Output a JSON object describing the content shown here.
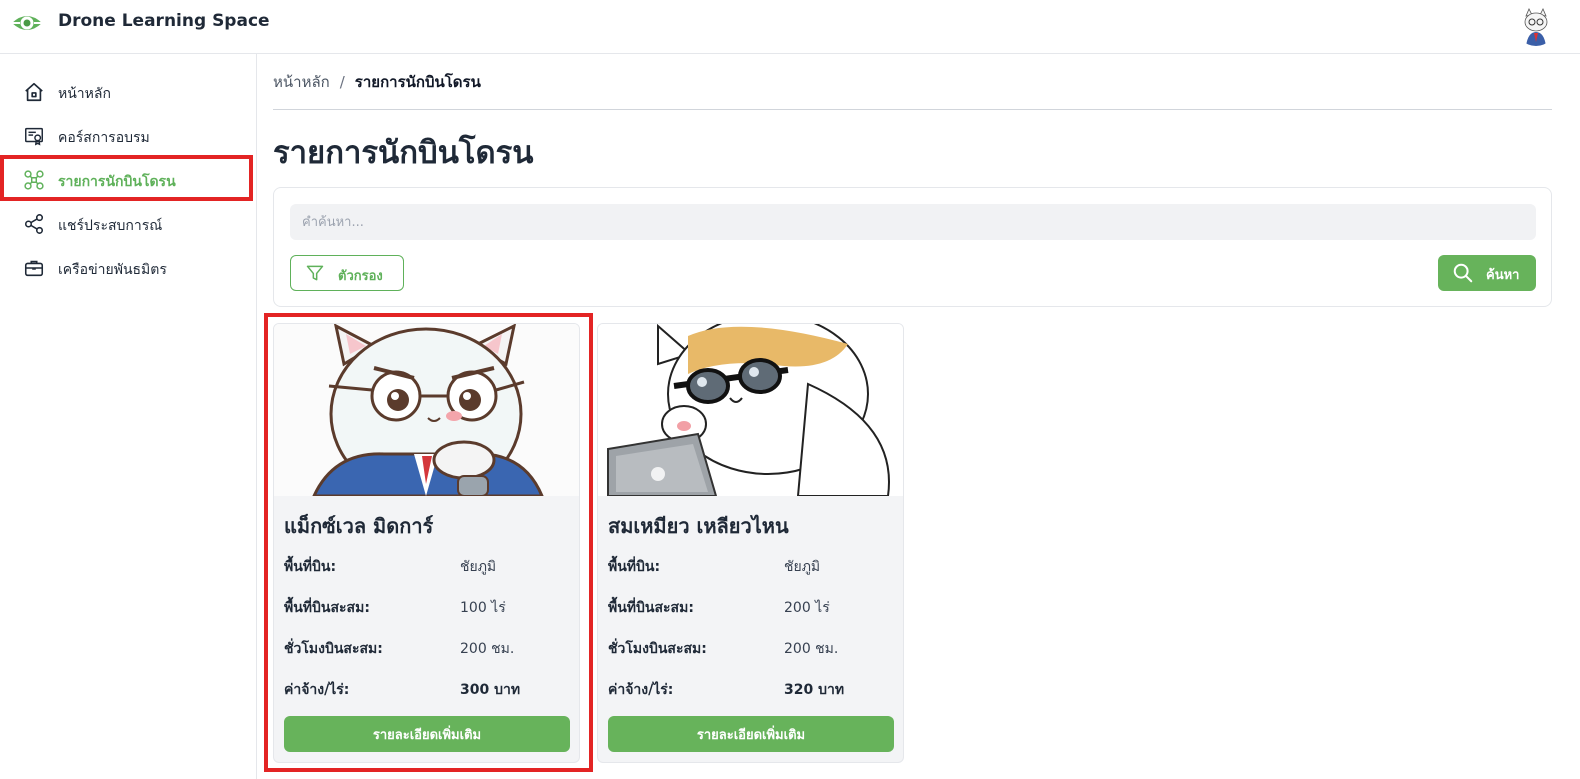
{
  "app": {
    "title": "Drone Learning Space",
    "accent_color": "#67b35b",
    "highlight_color": "#e32424",
    "logo_icon": "drone-eye-logo-icon",
    "avatar_icon": "cat-avatar-icon"
  },
  "sidebar": {
    "items": [
      {
        "label": "หน้าหลัก",
        "icon": "home-icon",
        "active": false
      },
      {
        "label": "คอร์สการอบรม",
        "icon": "certificate-icon",
        "active": false
      },
      {
        "label": "รายการนักบินโดรน",
        "icon": "drone-icon",
        "active": true
      },
      {
        "label": "แชร์ประสบการณ์",
        "icon": "share-icon",
        "active": false
      },
      {
        "label": "เครือข่ายพันธมิตร",
        "icon": "briefcase-icon",
        "active": false
      }
    ]
  },
  "breadcrumb": {
    "home": "หน้าหลัก",
    "separator": "/",
    "current": "รายการนักบินโดรน"
  },
  "page": {
    "title": "รายการนักบินโดรน"
  },
  "search": {
    "placeholder": "คำค้นหา...",
    "value": "",
    "filter_label": "ตัวกรอง",
    "filter_icon": "filter-icon",
    "search_label": "ค้นหา",
    "search_icon": "search-icon"
  },
  "pilots": [
    {
      "name": "แม็กซ์เวล มิดการ์",
      "image": "cat-pilot-glasses-suit-image",
      "fields": [
        {
          "label": "พื้นที่บิน:",
          "value": "ชัยภูมิ"
        },
        {
          "label": "พื้นที่บินสะสม:",
          "value": "100 ไร่"
        },
        {
          "label": "ชั่วโมงบินสะสม:",
          "value": "200 ชม."
        },
        {
          "label": "ค่าจ้าง/ไร่:",
          "value": "300 บาท"
        }
      ],
      "button_label": "รายละเอียดเพิ่มเติม"
    },
    {
      "name": "สมเหมียว เหลียวไหน",
      "image": "cat-pilot-sunglasses-laptop-image",
      "fields": [
        {
          "label": "พื้นที่บิน:",
          "value": "ชัยภูมิ"
        },
        {
          "label": "พื้นที่บินสะสม:",
          "value": "200 ไร่"
        },
        {
          "label": "ชั่วโมงบินสะสม:",
          "value": "200 ชม."
        },
        {
          "label": "ค่าจ้าง/ไร่:",
          "value": "320 บาท"
        }
      ],
      "button_label": "รายละเอียดเพิ่มเติม"
    }
  ]
}
